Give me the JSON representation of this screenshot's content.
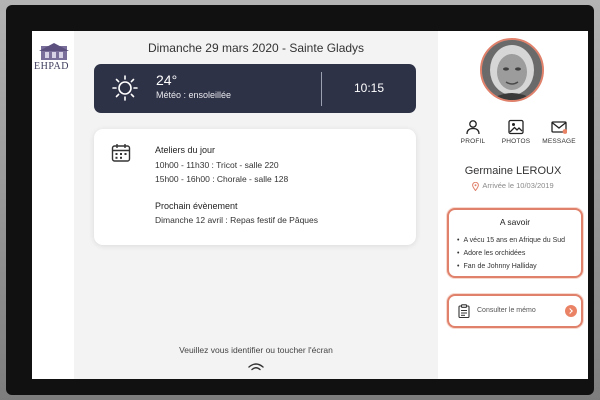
{
  "header": {
    "date_line": "Dimanche 29 mars 2020 - Sainte Gladys"
  },
  "logo": {
    "text": "EHPAD"
  },
  "weather": {
    "icon": "sun-icon",
    "temperature": "24°",
    "description": "Météo : ensoleillée",
    "time": "10:15"
  },
  "activities": {
    "icon": "calendar-icon",
    "title": "Ateliers du jour",
    "items": [
      "10h00 - 11h30 :  Tricot - salle 220",
      "15h00 - 16h00 :  Chorale - salle 128"
    ],
    "next_title": "Prochain évènement",
    "next_item": "Dimanche 12 avril : Repas festif de Pâques"
  },
  "footer": {
    "prompt": "Veuillez vous identifier ou toucher l'écran",
    "icon": "touch-wave-icon"
  },
  "resident": {
    "actions": [
      {
        "label": "PROFIL",
        "icon": "person-icon"
      },
      {
        "label": "PHOTOS",
        "icon": "photo-icon"
      },
      {
        "label": "MESSAGE",
        "icon": "mail-icon"
      }
    ],
    "name": "Germaine LEROUX",
    "arrival": "Arrivée le 10/03/2019",
    "about_title": "A savoir",
    "about_items": [
      "A vécu 15 ans en Afrique du Sud",
      "Adore les orchidées",
      "Fan de Johnny Halliday"
    ],
    "memo_label": "Consulter le mémo"
  },
  "colors": {
    "accent": "#e0816b",
    "banner": "#2e3247",
    "notification": "#ea8366"
  }
}
